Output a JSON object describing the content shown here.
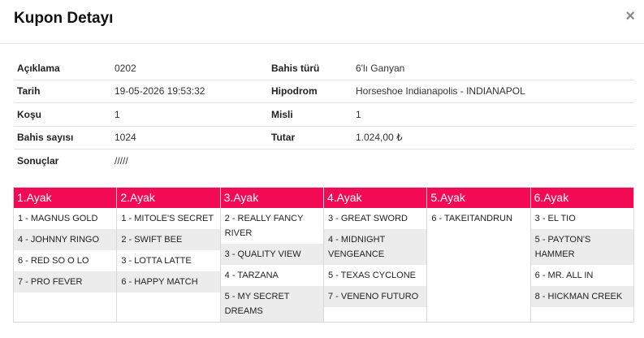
{
  "modal": {
    "title": "Kupon Detayı",
    "close_glyph": "×"
  },
  "details": {
    "rows": [
      {
        "l1": "Açıklama",
        "v1": "0202",
        "l2": "Bahis türü",
        "v2": "6'lı Ganyan"
      },
      {
        "l1": "Tarih",
        "v1": "19-05-2026 19:53:32",
        "l2": "Hipodrom",
        "v2": "Horseshoe Indianapolis - INDIANAPOL"
      },
      {
        "l1": "Koşu",
        "v1": "1",
        "l2": "Misli",
        "v2": "1"
      },
      {
        "l1": "Bahis sayısı",
        "v1": "1024",
        "l2": "Tutar",
        "v2": "1.024,00 ₺"
      },
      {
        "l1": "Sonuçlar",
        "v1": "/////",
        "l2": "",
        "v2": ""
      }
    ]
  },
  "legs": [
    {
      "title": "1.Ayak",
      "items": [
        "1 - MAGNUS GOLD",
        "4 - JOHNNY RINGO",
        "6 - RED SO O LO",
        "7 - PRO FEVER"
      ]
    },
    {
      "title": "2.Ayak",
      "items": [
        "1 - MITOLE'S SECRET",
        "2 - SWIFT BEE",
        "3 - LOTTA LATTE",
        "6 - HAPPY MATCH"
      ]
    },
    {
      "title": "3.Ayak",
      "items": [
        "2 - REALLY FANCY RIVER",
        "3 - QUALITY VIEW",
        "4 - TARZANA",
        "5 - MY SECRET DREAMS"
      ]
    },
    {
      "title": "4.Ayak",
      "items": [
        "3 - GREAT SWORD",
        "4 - MIDNIGHT VENGEANCE",
        "5 - TEXAS CYCLONE",
        "7 - VENENO FUTURO"
      ]
    },
    {
      "title": "5.Ayak",
      "items": [
        "6 - TAKEITANDRUN"
      ]
    },
    {
      "title": "6.Ayak",
      "items": [
        "3 - EL TIO",
        "5 - PAYTON'S HAMMER",
        "6 - MR. ALL IN",
        "8 - HICKMAN CREEK"
      ]
    }
  ],
  "colors": {
    "leg_header_bg": "#f20a55",
    "alt_row_bg": "#ececec"
  }
}
